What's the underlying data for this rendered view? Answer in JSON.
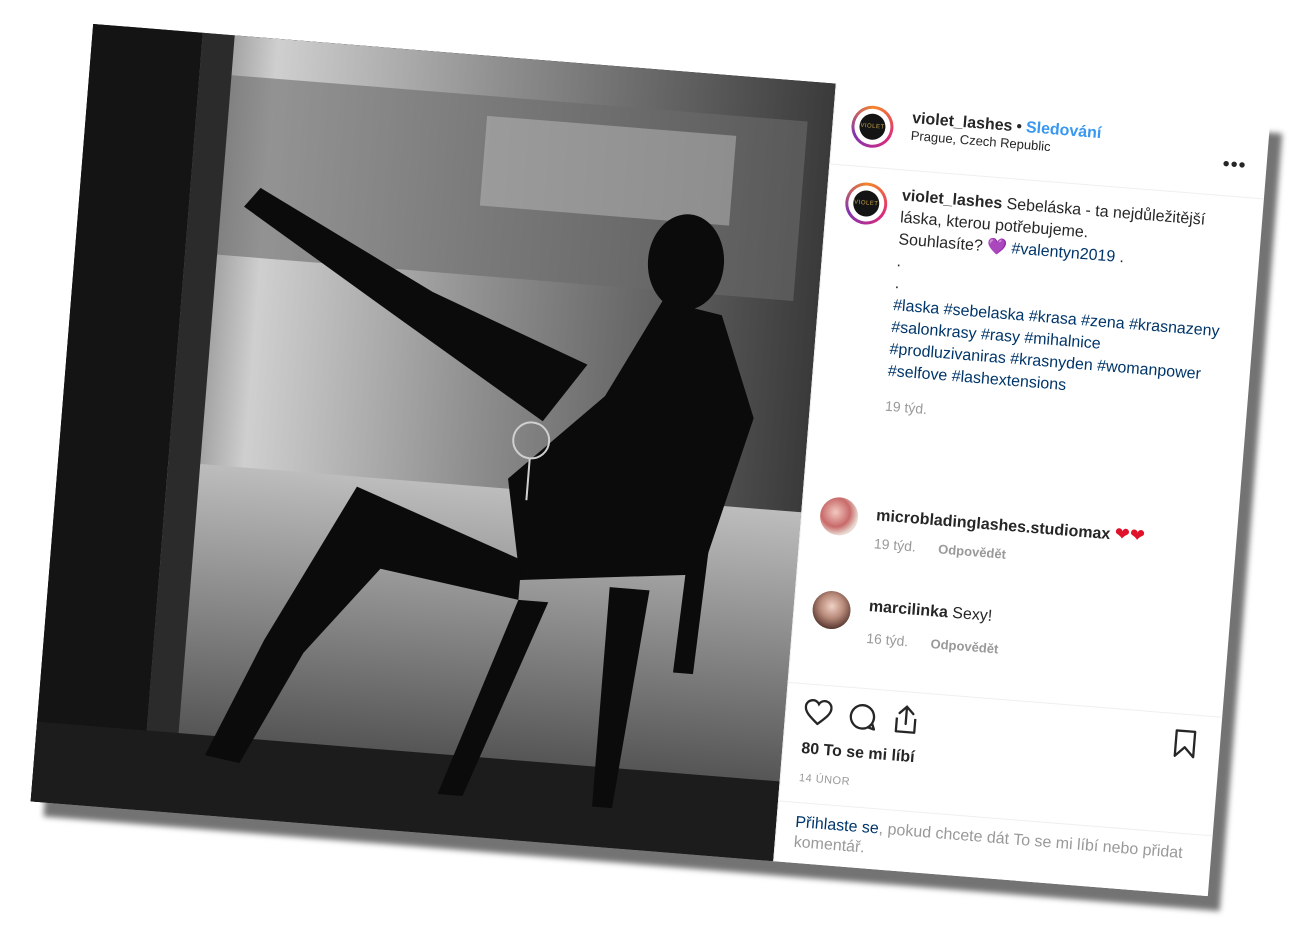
{
  "post": {
    "username": "violet_lashes",
    "separator": "•",
    "follow_label": "Sledování",
    "location": "Prague, Czech Republic",
    "more_label": "•••",
    "avatar_logo_text": "VIOLET",
    "caption": {
      "username": "violet_lashes",
      "line1": "Sebeláska - ta nejdůležitější láska, kterou potřebujeme.",
      "line2": "Souhlasíte?",
      "heart": "💜",
      "line2_tag": "#valentyn2019",
      "line2_end": ".",
      "dot1": ".",
      "dot2": ".",
      "hashtags": [
        "#laska",
        "#sebelaska",
        "#krasa",
        "#zena",
        "#krasnazeny",
        "#salonkrasy",
        "#rasy",
        "#mihalnice",
        "#prodluzivaniras",
        "#krasnyden",
        "#womanpower",
        "#selfove",
        "#lashextensions"
      ],
      "age": "19 týd."
    },
    "comments": [
      {
        "username": "microbladinglashes.studiomax",
        "text": "❤❤",
        "age": "19 týd.",
        "reply": "Odpovědět"
      },
      {
        "username": "marcilinka",
        "text": "Sexy!",
        "age": "16 týd.",
        "reply": "Odpovědět"
      }
    ],
    "icons": {
      "like": "heart-icon",
      "comment": "comment-icon",
      "share": "share-icon",
      "save": "bookmark-icon"
    },
    "likes": "80 To se mi líbí",
    "date": "14 ÚNOR",
    "login": {
      "link": "Přihlaste se",
      "rest": ", pokud chcete dát To se mi líbí nebo přidat komentář."
    }
  }
}
